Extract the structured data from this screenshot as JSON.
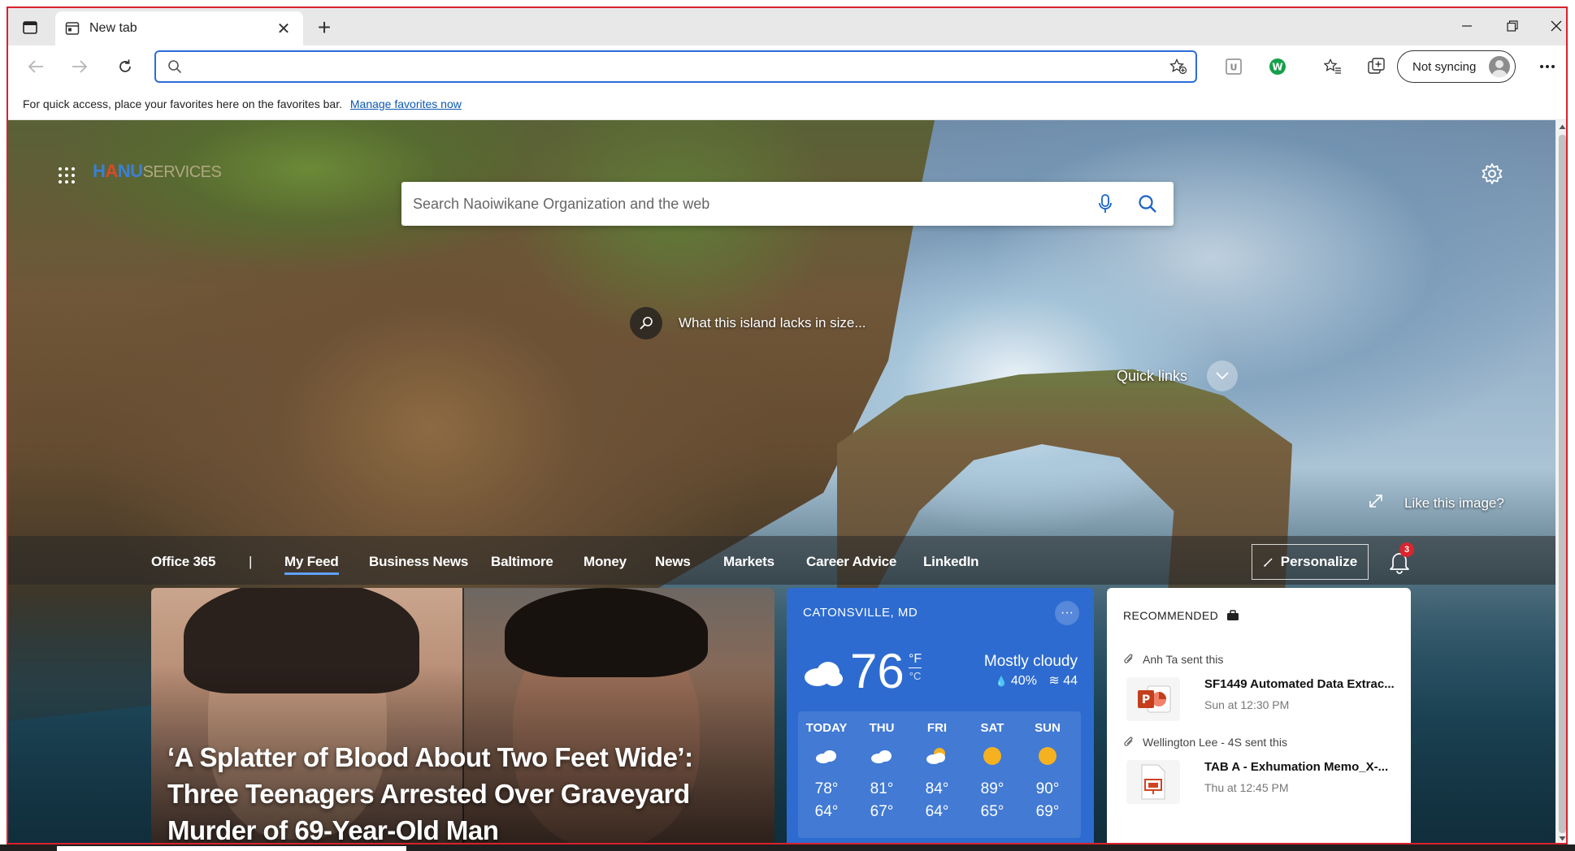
{
  "browser": {
    "tab_title": "New tab",
    "address_value": "",
    "sync_label": "Not syncing",
    "favorites_bar_text": "For quick access, place your favorites here on the favorites bar.",
    "favorites_bar_link": "Manage favorites now"
  },
  "newtab": {
    "logo": {
      "part1": "H",
      "part2": "A",
      "part3": "NU",
      "part4": "SERVICES"
    },
    "search_placeholder": "Search Naoiwikane Organization and the web",
    "image_caption": "What this island lacks in size...",
    "quick_links_label": "Quick links",
    "like_image_label": "Like this image?",
    "feed_tabs": [
      "Office 365",
      "|",
      "My Feed",
      "Business News",
      "Baltimore",
      "Money",
      "News",
      "Markets",
      "Career Advice",
      "LinkedIn"
    ],
    "active_feed_tab": "My Feed",
    "personalize_label": "Personalize",
    "notification_count": "3"
  },
  "news": {
    "headline": "‘A Splatter of Blood About Two Feet Wide’: Three Teenagers Arrested Over Graveyard Murder of 69-Year-Old Man"
  },
  "weather": {
    "location": "CATONSVILLE, MD",
    "more_label": "···",
    "temp": "76",
    "unit_f": "°F",
    "unit_c": "°C",
    "condition": "Mostly cloudy",
    "precip": "40%",
    "wind": "44",
    "forecast": [
      {
        "day": "TODAY",
        "icon": "cloud-icon",
        "high": "78°",
        "low": "64°"
      },
      {
        "day": "THU",
        "icon": "cloud-icon",
        "high": "81°",
        "low": "67°"
      },
      {
        "day": "FRI",
        "icon": "partly-cloudy-icon",
        "high": "84°",
        "low": "64°"
      },
      {
        "day": "SAT",
        "icon": "sun-icon",
        "high": "89°",
        "low": "65°"
      },
      {
        "day": "SUN",
        "icon": "sun-icon",
        "high": "90°",
        "low": "69°"
      }
    ]
  },
  "recommended": {
    "title": "RECOMMENDED",
    "items": [
      {
        "sender": "Anh Ta sent this",
        "name": "SF1449 Automated Data Extrac...",
        "time": "Sun at 12:30 PM",
        "icon": "powerpoint-icon"
      },
      {
        "sender": "Wellington Lee - 4S sent this",
        "name": "TAB A - Exhumation Memo_X-...",
        "time": "Thu at 12:45 PM",
        "icon": "presentation-file-icon"
      }
    ]
  },
  "colors": {
    "accent": "#2f6bd8",
    "frame_border": "#d9212c",
    "weather_bg": "#2d6bd0",
    "badge": "#d9252e"
  }
}
